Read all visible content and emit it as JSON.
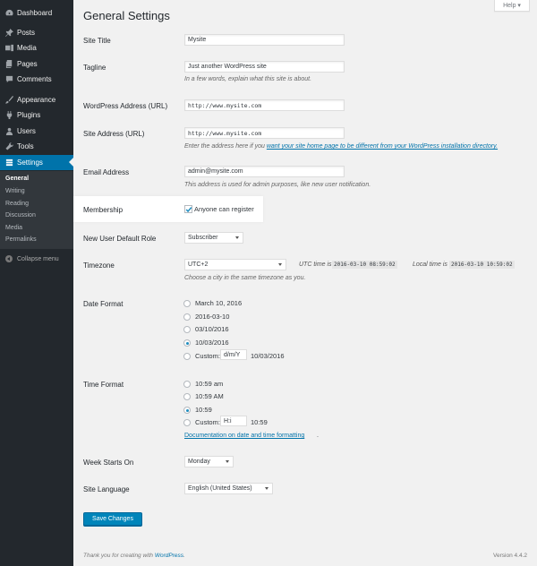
{
  "sidebar": {
    "items": [
      {
        "label": "Dashboard",
        "icon": "dashboard-icon"
      },
      {
        "label": "Posts",
        "icon": "pin-icon"
      },
      {
        "label": "Media",
        "icon": "media-icon"
      },
      {
        "label": "Pages",
        "icon": "pages-icon"
      },
      {
        "label": "Comments",
        "icon": "comment-icon"
      },
      {
        "label": "Appearance",
        "icon": "brush-icon"
      },
      {
        "label": "Plugins",
        "icon": "plugin-icon"
      },
      {
        "label": "Users",
        "icon": "users-icon"
      },
      {
        "label": "Tools",
        "icon": "wrench-icon"
      },
      {
        "label": "Settings",
        "icon": "settings-icon"
      }
    ],
    "submenu": [
      "General",
      "Writing",
      "Reading",
      "Discussion",
      "Media",
      "Permalinks"
    ],
    "collapse_label": "Collapse menu",
    "accent": "#0073aa"
  },
  "header": {
    "help_label": "Help ▾",
    "title": "General Settings"
  },
  "form": {
    "site_title": {
      "label": "Site Title",
      "value": "Mysite"
    },
    "tagline": {
      "label": "Tagline",
      "value": "Just another WordPress site",
      "desc": "In a few words, explain what this site is about."
    },
    "wp_address": {
      "label": "WordPress Address (URL)",
      "value": "http://www.mysite.com"
    },
    "site_address": {
      "label": "Site Address (URL)",
      "value": "http://www.mysite.com",
      "desc_prefix": "Enter the address here if you ",
      "desc_link": "want your site home page to be different from your WordPress installation directory."
    },
    "email": {
      "label": "Email Address",
      "value": "admin@mysite.com",
      "desc": "This address is used for admin purposes, like new user notification."
    },
    "membership": {
      "label": "Membership",
      "option": "Anyone can register",
      "checked": true
    },
    "default_role": {
      "label": "New User Default Role",
      "value": "Subscriber"
    },
    "timezone": {
      "label": "Timezone",
      "value": "UTC+2",
      "utc_label": "UTC time is",
      "utc_value": "2016-03-10 08:59:02",
      "local_label": "Local time is",
      "local_value": "2016-03-10 10:59:02",
      "desc": "Choose a city in the same timezone as you."
    },
    "date_format": {
      "label": "Date Format",
      "options": [
        "March 10, 2016",
        "2016-03-10",
        "03/10/2016",
        "10/03/2016"
      ],
      "selected_index": 3,
      "custom_label": "Custom:",
      "custom_value": "d/m/Y",
      "custom_preview": "10/03/2016"
    },
    "time_format": {
      "label": "Time Format",
      "options": [
        "10:59 am",
        "10:59 AM",
        "10:59"
      ],
      "selected_index": 2,
      "custom_label": "Custom:",
      "custom_value": "H:i",
      "custom_preview": "10:59",
      "doc_link": "Documentation on date and time formatting"
    },
    "week_start": {
      "label": "Week Starts On",
      "value": "Monday"
    },
    "site_language": {
      "label": "Site Language",
      "value": "English (United States)"
    },
    "save_label": "Save Changes"
  },
  "footer": {
    "thanks_prefix": "Thank you for creating with ",
    "thanks_link": "WordPress",
    "version": "Version 4.4.2"
  }
}
